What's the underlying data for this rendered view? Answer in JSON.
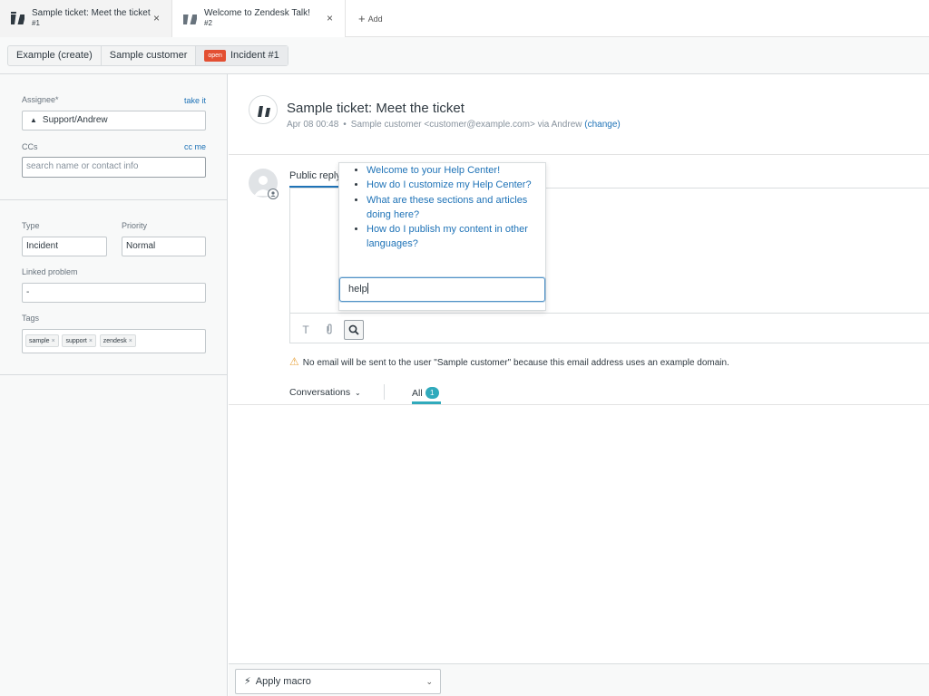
{
  "tabs": [
    {
      "title": "Sample ticket: Meet the ticket",
      "number": "#1",
      "close": "×"
    },
    {
      "title": "Welcome to Zendesk Talk!",
      "number": "#2",
      "close": "×"
    }
  ],
  "add_tab": {
    "icon": "plus-icon",
    "label": "Add"
  },
  "breadcrumb": {
    "items": [
      "Example (create)",
      "Sample customer"
    ],
    "status": "open",
    "current": "Incident #1"
  },
  "sidebar": {
    "assignee": {
      "label": "Assignee*",
      "link": "take it",
      "value": "Support/Andrew"
    },
    "ccs": {
      "label": "CCs",
      "link": "cc me",
      "placeholder": "search name or contact info"
    },
    "type": {
      "label": "Type",
      "value": "Incident"
    },
    "priority": {
      "label": "Priority",
      "value": "Normal"
    },
    "linked_problem": {
      "label": "Linked problem",
      "value": "-"
    },
    "tags": {
      "label": "Tags",
      "items": [
        "sample",
        "support",
        "zendesk"
      ],
      "remove": "×"
    }
  },
  "ticket": {
    "title": "Sample ticket: Meet the ticket",
    "date": "Apr 08 00:48",
    "requester": "Sample customer <customer@example.com> via Andrew",
    "change_link": "(change)"
  },
  "reply": {
    "tab_label": "Public reply",
    "tools": [
      "text-format-icon",
      "attachment-icon",
      "search-icon"
    ]
  },
  "kb_popup": {
    "articles": [
      "Welcome to your Help Center!",
      "How do I customize my Help Center?",
      "What are these sections and articles doing here?",
      "How do I publish my content in other languages?"
    ],
    "search_value": "help"
  },
  "warning": "No email will be sent to the user \"Sample customer\" because this email address uses an example domain.",
  "conversations": {
    "label": "Conversations",
    "all_label": "All",
    "all_count": "1"
  },
  "footer": {
    "macro_label": "Apply macro"
  },
  "colors": {
    "accent": "#1f73b7",
    "status_open": "#e34f32",
    "badge": "#30aabc",
    "warning": "#e8a33d"
  }
}
